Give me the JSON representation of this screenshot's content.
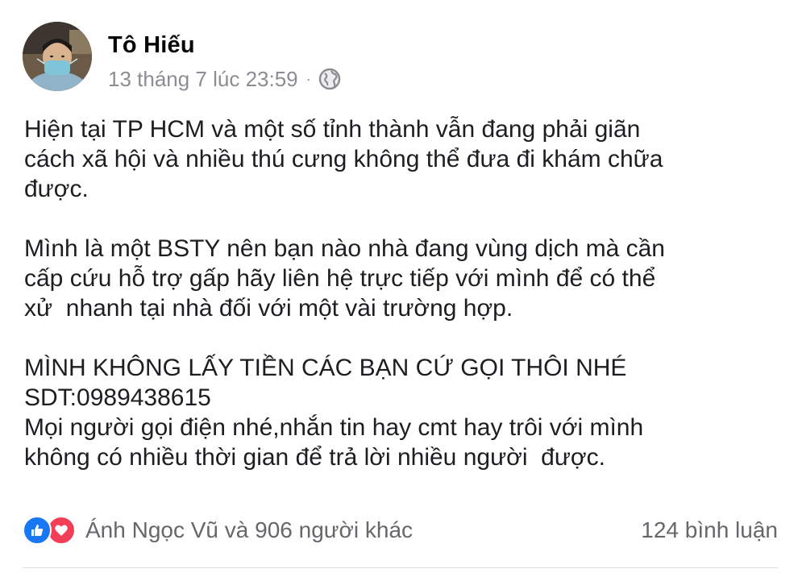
{
  "post": {
    "author": "Tô Hiếu",
    "date": "13 tháng 7 lúc 23:59",
    "separator": "·",
    "privacy_icon": "globe-icon",
    "paragraphs": [
      "Hiện tại TP HCM và một số tỉnh thành vẫn đang phải giãn\ncách xã hội và nhiều thú cưng không thể đưa đi khám chữa\nđược.",
      "Mình là một BSTY nên bạn nào nhà đang vùng dịch mà cần\ncấp cứu hỗ trợ gấp hãy liên hệ trực tiếp với mình để có thể\nxử  nhanh tại nhà đối với một vài trường hợp.",
      "MÌNH KHÔNG LẤY TIỀN CÁC BẠN CỨ GỌI THÔI NHÉ\nSDT:0989438615\nMọi người gọi điện nhé,nhắn tin hay cmt hay trôi với mình\nkhông có nhiều thời gian để trả lời nhiều người  được."
    ]
  },
  "footer": {
    "reactions_text": "Ánh Ngọc Vũ và 906 người khác",
    "comments_text": "124 bình luận",
    "reaction_icons": [
      "like-icon",
      "love-icon"
    ]
  },
  "colors": {
    "like": "#1877f2",
    "love": "#f33e58",
    "meta_text": "#8a8d91",
    "body_text": "#1c1e21"
  }
}
